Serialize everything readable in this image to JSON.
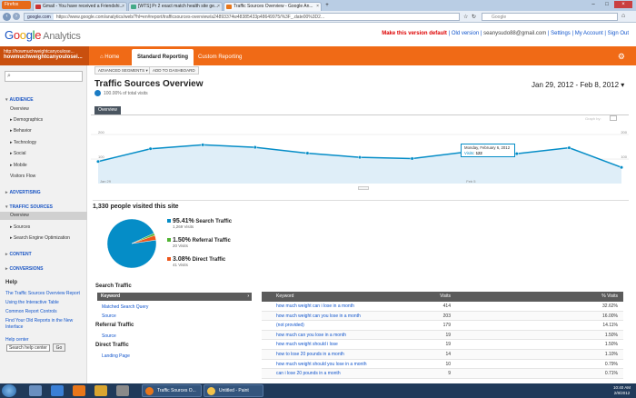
{
  "browser": {
    "app_button": "Firefox",
    "tabs": [
      {
        "label": "Gmail - You have received a Friendshi...",
        "icon": "gmail-icon",
        "color": "#c33"
      },
      {
        "label": "[WTS] Pr 2 exact match health site ge...",
        "icon": "forum-icon",
        "color": "#4a8"
      },
      {
        "label": "Traffic Sources Overview - Google An...",
        "icon": "analytics-icon",
        "color": "#e8761a"
      }
    ],
    "url_site": "google.com",
    "url_rest": "https://www.google.com/analytics/web/?hl=en#report/trafficsources-overview/a24893374w48385433p48649975/%3F_.date00%3D2...",
    "search_placeholder": "Google"
  },
  "ga": {
    "logo": {
      "g": "G",
      "o1": "o",
      "o2": "o",
      "g2": "g",
      "l": "l",
      "e": "e",
      "analytics": " Analytics"
    },
    "toplinks": {
      "default": "Make this version default",
      "old": "Old version",
      "email": "seanysudo88@gmail.com",
      "settings": "Settings",
      "account": "My Account",
      "signout": "Sign Out"
    },
    "account": {
      "line1": "http://howmuchweightcanyoulose...",
      "line2": "howmuchweightcanyoulosei..."
    },
    "tabs": [
      "Home",
      "Standard Reporting",
      "Custom Reporting"
    ]
  },
  "sidebar": {
    "sections": [
      {
        "label": "AUDIENCE",
        "items": [
          "Overview",
          "Demographics",
          "Behavior",
          "Technology",
          "Social",
          "Mobile",
          "Visitors Flow"
        ]
      },
      {
        "label": "ADVERTISING"
      },
      {
        "label": "TRAFFIC SOURCES",
        "items": [
          "Overview",
          "Sources",
          "Search Engine Optimization"
        ]
      },
      {
        "label": "CONTENT"
      },
      {
        "label": "CONVERSIONS"
      }
    ],
    "help": {
      "title": "Help",
      "links": [
        "The Traffic Sources Overview Report",
        "Using the Interactive Table",
        "Common Report Controls",
        "Find Your Old Reports in the New",
        "Interface"
      ],
      "center": "Help center",
      "search_value": "Search help center",
      "go": "Go"
    }
  },
  "report": {
    "buttons": [
      "ADVANCED SEGMENTS",
      "ADD TO DASHBOARD"
    ],
    "title": "Traffic Sources Overview",
    "subinfo": "100.00% of total visits",
    "date_range": "Jan 29, 2012 - Feb 8, 2012",
    "overview_tab": "Overview",
    "graph_by": "Graph by:",
    "visited": "1,330 people visited this site",
    "tooltip": {
      "date": "Monday, February 6, 2012",
      "label": "Visits",
      "value": "122"
    }
  },
  "chart_data": {
    "type": "area",
    "x": [
      "Jan 29",
      "Jan 30",
      "Jan 31",
      "Feb 1",
      "Feb 2",
      "Feb 3",
      "Feb 4",
      "Feb 5",
      "Feb 6",
      "Feb 7",
      "Feb 8"
    ],
    "series": [
      {
        "name": "Visits",
        "values": [
          90,
          142,
          158,
          148,
          124,
          107,
          102,
          128,
          122,
          146,
          66
        ]
      }
    ],
    "ytick_labels": [
      "200",
      "100"
    ],
    "xtick_labels": [
      "Jan 29",
      "Feb 5"
    ],
    "ylim": [
      0,
      230
    ],
    "color": "#058dc7"
  },
  "pie": {
    "slices": [
      {
        "name": "Search Traffic",
        "pct": "95.41%",
        "visits": "1,269 Visits",
        "value": 95.41,
        "color": "#058dc7"
      },
      {
        "name": "Referral Traffic",
        "pct": "1.50%",
        "visits": "20 Visits",
        "value": 1.5,
        "color": "#50b432"
      },
      {
        "name": "Direct Traffic",
        "pct": "3.08%",
        "visits": "41 Visits",
        "value": 3.08,
        "color": "#ed561b"
      }
    ]
  },
  "left_lists": {
    "search": {
      "title": "Search Traffic",
      "selected": "Keyword",
      "links": [
        "Matched Search Query",
        "Source"
      ]
    },
    "referral": {
      "title": "Referral Traffic",
      "links": [
        "Source"
      ]
    },
    "direct": {
      "title": "Direct Traffic",
      "links": [
        "Landing Page"
      ]
    }
  },
  "table": {
    "headers": [
      "Keyword",
      "Visits",
      "% Visits"
    ],
    "rows": [
      [
        "how much weight can i lose in a month",
        "414",
        "32.62%"
      ],
      [
        "how much weight can you lose in a month",
        "203",
        "16.00%"
      ],
      [
        "(not provided)",
        "179",
        "14.11%"
      ],
      [
        "how much can you lose in a month",
        "19",
        "1.50%"
      ],
      [
        "how much weight should i lose",
        "19",
        "1.50%"
      ],
      [
        "how to lose 20 pounds in a month",
        "14",
        "1.10%"
      ],
      [
        "how much weight should you lose in a month",
        "10",
        "0.79%"
      ],
      [
        "can i lose 20 pounds in a month",
        "9",
        "0.71%"
      ]
    ]
  },
  "taskbar": {
    "items": [
      {
        "label": "Traffic Sources O...",
        "color": "#e8761a"
      },
      {
        "label": "Untitled - Paint",
        "color": "#f3c24a"
      }
    ],
    "time": "10:40 AM",
    "date": "2/8/2012"
  }
}
